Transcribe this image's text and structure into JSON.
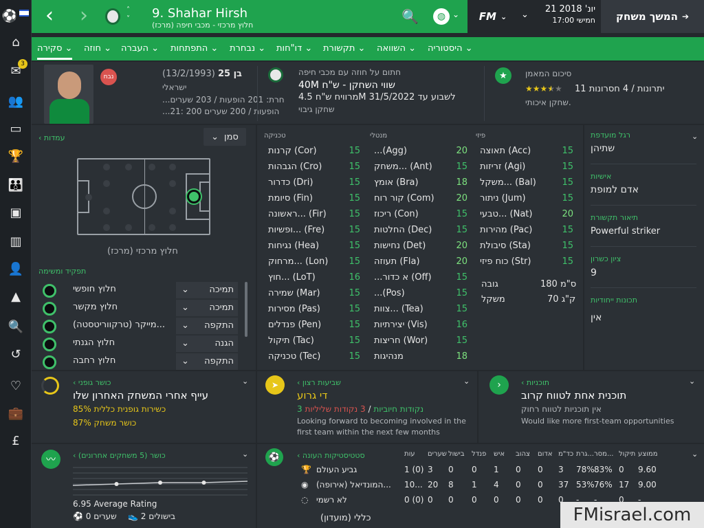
{
  "app": {
    "badge_count": "3"
  },
  "topbar": {
    "player_title": "9. Shahar Hirsh",
    "player_subtitle": "(מרכז) חלוץ מרכזי - מכבי חיפה",
    "fm_label": "FM",
    "date": "21 יונ' 2018",
    "time_day": "17:00 חמישי",
    "continue_label": "המשך משחק"
  },
  "tabs": [
    "סקירה",
    "חוזה",
    "העברה",
    "התפתחות",
    "נבחרת",
    "דו\"חות",
    "תקשורת",
    "השוואה",
    "היסטוריה"
  ],
  "summary": {
    "age": "בן 25",
    "dob": "(13/2/1993)",
    "nationality": "ישראלי",
    "status_badge": "נבח",
    "line1": "...חרת: 201 הופעות / 203 שערים",
    "line2": "...21: 200 הופעות / 200 שערים",
    "contract_header": "חתום על חוזה עם מכבי חיפה",
    "value": "40M שווי השחקן - ש\"ח",
    "wage": "מרוויח ש\"ח 4.5M לשבוע עד 31/5/2022",
    "role_squad": "שחקן גיבוי",
    "scout_header": "סיכום המאמן",
    "strengths": "11 יתרונות / 4 חסרונות",
    "scout_desc": "שחקן איכותי.",
    "stars": "★★★★★"
  },
  "position_panel": {
    "positions_link": "עמדות",
    "mark_dropdown": "סמן",
    "position_label": "(מרכז) חלוץ מרכזי",
    "role_header": "תפקיד ומשימה",
    "roles": [
      {
        "name": "חלוץ חופשי",
        "duty": "תמיכה"
      },
      {
        "name": "חלוץ מקשר",
        "duty": "תמיכה"
      },
      {
        "name": "מייקר (טרקווריטסטה)...",
        "duty": "התקפה"
      },
      {
        "name": "חלוץ הגנתי",
        "duty": "הגנה"
      },
      {
        "name": "חלוץ רחבה",
        "duty": "התקפה"
      }
    ]
  },
  "attributes": {
    "technical_header": "טכניקה",
    "mental_header": "מנטלי",
    "physical_header": "פיזי",
    "technical": [
      {
        "name": "קרנות (Cor)",
        "value": "15"
      },
      {
        "name": "הגבהות (Cro)",
        "value": "15"
      },
      {
        "name": "כדרור (Dri)",
        "value": "15"
      },
      {
        "name": "סיומת (Fin)",
        "value": "15"
      },
      {
        "name": "ראשונה... (Fir)",
        "value": "15"
      },
      {
        "name": "ופשיות... (Fre)",
        "value": "15"
      },
      {
        "name": "נגיחות (Hea)",
        "value": "15"
      },
      {
        "name": "מרחוק... (Lon)",
        "value": "15"
      },
      {
        "name": "חוץ... (LoT)",
        "value": "16"
      },
      {
        "name": "שמירה (Mar)",
        "value": "15"
      },
      {
        "name": "מסירות (Pas)",
        "value": "15"
      },
      {
        "name": "פנדלים (Pen)",
        "value": "15"
      },
      {
        "name": "תיקול (Tac)",
        "value": "15"
      },
      {
        "name": "טכניקה (Tec)",
        "value": "15"
      }
    ],
    "mental": [
      {
        "name": "...(Agg)",
        "value": "20"
      },
      {
        "name": "משחק... (Ant)",
        "value": "15"
      },
      {
        "name": "אומץ (Bra)",
        "value": "18"
      },
      {
        "name": "קור רוח (Com)",
        "value": "20"
      },
      {
        "name": "ריכוז (Con)",
        "value": "15"
      },
      {
        "name": "החלטות (Dec)",
        "value": "15"
      },
      {
        "name": "נחישות (Det)",
        "value": "20"
      },
      {
        "name": "תעוזה (Fla)",
        "value": "20"
      },
      {
        "name": "...א כדור (Off)",
        "value": "15"
      },
      {
        "name": "...(Pos)",
        "value": "15"
      },
      {
        "name": "צוות... (Tea)",
        "value": "15"
      },
      {
        "name": "יצירתיות (Vis)",
        "value": "16"
      },
      {
        "name": "חריצות (Wor)",
        "value": "15"
      },
      {
        "name": "מנהיגות",
        "value": "18"
      }
    ],
    "physical": [
      {
        "name": "תאוצה (Acc)",
        "value": "15"
      },
      {
        "name": "זריזות (Agi)",
        "value": "15"
      },
      {
        "name": "משקל... (Bal)",
        "value": "15"
      },
      {
        "name": "ניתור (Jum)",
        "value": "15"
      },
      {
        "name": "טבעי... (Nat)",
        "value": "20"
      },
      {
        "name": "מהירות (Pac)",
        "value": "15"
      },
      {
        "name": "סיבולת (Sta)",
        "value": "15"
      },
      {
        "name": "כוח פיזי (Str)",
        "value": "15"
      }
    ],
    "height_label": "גובה",
    "height": "180 ס\"מ",
    "weight_label": "משקל",
    "weight": "70 ק\"ג"
  },
  "details": {
    "foot_label": "רגל מועדפת",
    "foot": "שתיהן",
    "personality_label": "אישיות",
    "personality": "אדם למופת",
    "media_label": "תיאור תקשורת",
    "media": "Powerful striker",
    "rating_label": "ציון כשרון",
    "rating": "9",
    "traits_label": "תכונות ייחודיות",
    "traits": "אין"
  },
  "bottom": {
    "fitness_title": "כושר גופני",
    "fitness_headline": "עייף אחרי המשחק האחרון שלו",
    "fitness_line1": "85% כשירות גופנית כללית",
    "fitness_line2": "87% כושר משחק",
    "happiness_title": "שביעות רצון",
    "happiness_headline": "די גרוע",
    "neg_points": "3 נקודות שליליות",
    "pos_points": "3 נקודות חיוביות",
    "happiness_desc1": "Looking forward to becoming involved in the",
    "happiness_desc2": "first team within the next few months",
    "plans_title": "תוכניות",
    "plans_headline": "תוכנית אחת לטווח קרוב",
    "plans_sub": "אין תוכניות לטווח רחוק",
    "plans_desc": "Would like more first-team opportunities",
    "form_title": "כושר (5 משחקים אחרונים)",
    "avg_rating": "6.95 Average Rating",
    "goals": "0 שערים",
    "assists": "2 בישולים",
    "stats_title": "סטטיסטיקות העונה",
    "stats_headers": [
      "עות",
      "שערים",
      "בישול",
      "פנדל",
      "איש",
      "צהוב",
      "אדום",
      "כד\"מ",
      "גרת...",
      "מסר...",
      "תיקול",
      "ממוצע"
    ],
    "stats_rows": [
      {
        "comp": "גביע העולם",
        "cells": [
          "1 (0)",
          "3",
          "0",
          "0",
          "1",
          "0",
          "0",
          "3",
          "78%",
          "83%",
          "0",
          "9.60"
        ]
      },
      {
        "comp": "המונדיאל (אירופה)...",
        "cells": [
          "10...",
          "20",
          "8",
          "1",
          "4",
          "0",
          "0",
          "37",
          "53%",
          "76%",
          "17",
          "9.00"
        ]
      },
      {
        "comp": "לא רשמי",
        "cells": [
          "0 (0)",
          "0",
          "0",
          "0",
          "0",
          "0",
          "0",
          "0",
          "-",
          "-",
          "0",
          "-"
        ]
      }
    ],
    "stats_footer": "כללי (מועדון)"
  },
  "watermark": "FMisrael.com",
  "colors": {
    "accent": "#1fa34e",
    "background": "#24282c",
    "star": "#e7c619"
  },
  "form_chart": {
    "type": "line",
    "values": [
      6.8,
      6.9,
      7.0,
      7.0,
      7.1
    ]
  }
}
